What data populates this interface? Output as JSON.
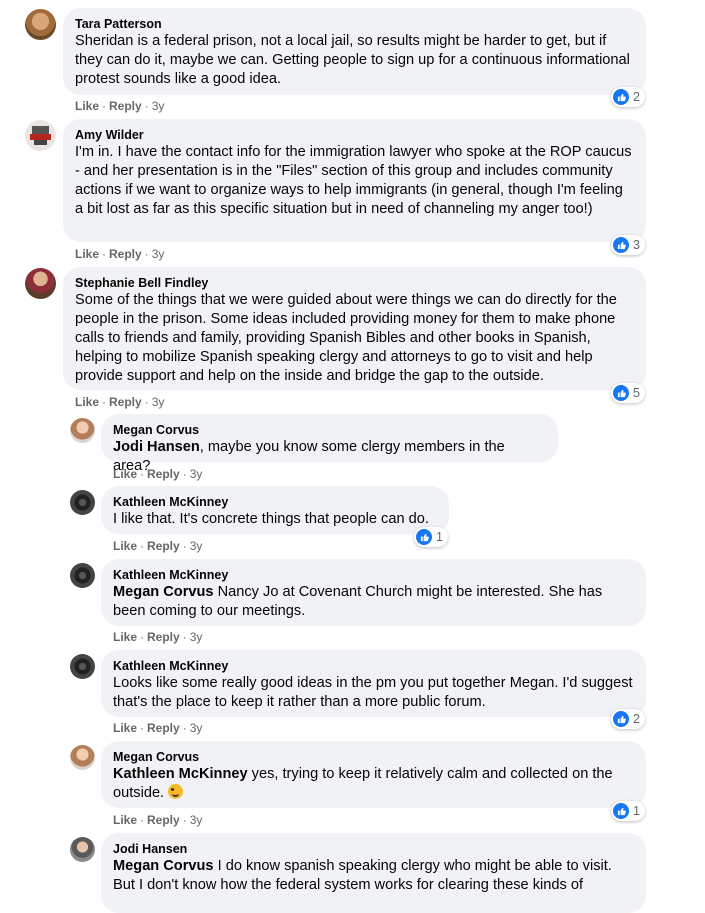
{
  "comments": [
    {
      "author": "Tara Patterson",
      "text": "Sheridan is a federal prison, not a local jail, so results might be harder to get, but if they can do it, maybe we can. Getting people to sign up for a continuous informational protest sounds like a good idea.",
      "like": "Like",
      "reply": "Reply",
      "time": "3y",
      "reactions": "2"
    },
    {
      "author": "Amy Wilder",
      "text": "I'm in. I have the contact info for the immigration lawyer who spoke at the ROP caucus - and her presentation is in the \"Files\" section of this group and includes community actions if we want to organize ways to help immigrants (in general, though I'm feeling a bit lost as far as this specific situation but in need of channeling my anger too!)",
      "like": "Like",
      "reply": "Reply",
      "time": "3y",
      "reactions": "3"
    },
    {
      "author": "Stephanie Bell Findley",
      "text": "Some of the things that we were guided about were things we can do directly for the people in the prison. Some ideas included providing money for them to make phone calls to friends and family, providing Spanish Bibles and other books in Spanish, helping to mobilize Spanish speaking clergy and attorneys to go to visit and help provide support and help on the inside and bridge the gap to the outside.",
      "like": "Like",
      "reply": "Reply",
      "time": "3y",
      "reactions": "5"
    }
  ],
  "replies": [
    {
      "author": "Megan Corvus",
      "mention": "Jodi Hansen",
      "text": ", maybe you know some clergy members in the area?",
      "like": "Like",
      "reply": "Reply",
      "time": "3y"
    },
    {
      "author": "Kathleen McKinney",
      "text": "I like that. It's concrete things that people can do.",
      "like": "Like",
      "reply": "Reply",
      "time": "3y",
      "reactions": "1"
    },
    {
      "author": "Kathleen McKinney",
      "mention": "Megan Corvus",
      "text": " Nancy Jo at Covenant Church might be interested. She has been coming to our meetings.",
      "like": "Like",
      "reply": "Reply",
      "time": "3y"
    },
    {
      "author": "Kathleen McKinney",
      "text": "Looks like some really good ideas in the pm you put together Megan. I'd suggest that's the place to keep it rather than a more public forum.",
      "like": "Like",
      "reply": "Reply",
      "time": "3y",
      "reactions": "2"
    },
    {
      "author": "Megan Corvus",
      "mention": "Kathleen McKinney",
      "text": " yes, trying to keep it relatively calm and collected on the outside.",
      "like": "Like",
      "reply": "Reply",
      "time": "3y",
      "reactions": "1"
    },
    {
      "author": "Jodi Hansen",
      "mention": "Megan Corvus",
      "text": " I do know spanish speaking clergy who might be able to visit. But I don't know how the federal system works for clearing these kinds of",
      "like": "Like",
      "reply": "Reply",
      "time": "3y"
    }
  ],
  "colors": {
    "bubble": "#f0f2f5",
    "like_blue": "#1877f2",
    "meta_gray": "#65676b"
  }
}
